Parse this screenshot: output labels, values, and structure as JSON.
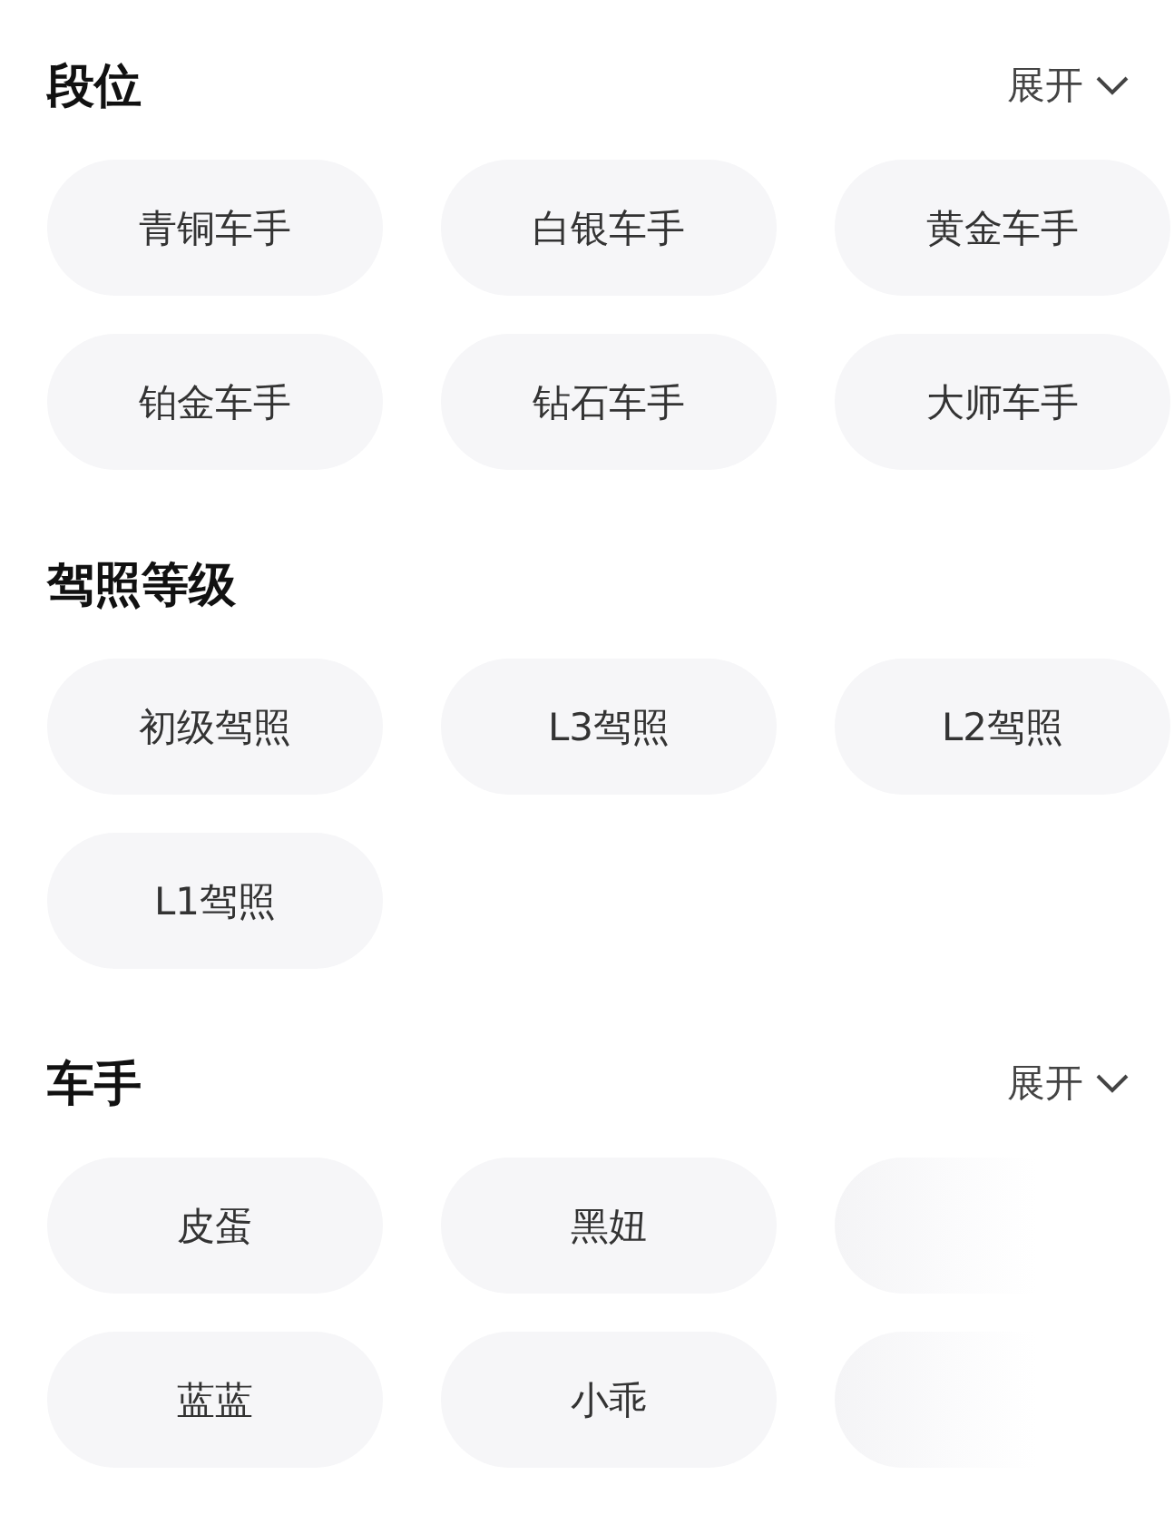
{
  "sections": [
    {
      "title": "段位",
      "expand_label": "展开",
      "chips": [
        {
          "kind": "text",
          "label": "青铜车手"
        },
        {
          "kind": "text",
          "label": "白银车手"
        },
        {
          "kind": "text",
          "label": "黄金车手"
        },
        {
          "kind": "text",
          "label": "铂金车手"
        },
        {
          "kind": "text",
          "label": "钻石车手"
        },
        {
          "kind": "text",
          "label": "大师车手"
        }
      ]
    },
    {
      "title": "驾照等级",
      "chips": [
        {
          "kind": "text",
          "label": "初级驾照"
        },
        {
          "kind": "text",
          "label": "L3驾照"
        },
        {
          "kind": "text",
          "label": "L2驾照"
        },
        {
          "kind": "text",
          "label": "L1驾照"
        }
      ]
    },
    {
      "title": "车手",
      "expand_label": "展开",
      "chips": [
        {
          "kind": "text",
          "label": "皮蛋"
        },
        {
          "kind": "text",
          "label": "黑妞"
        },
        {
          "kind": "faded"
        },
        {
          "kind": "text",
          "label": "蓝蓝"
        },
        {
          "kind": "text",
          "label": "小乖"
        },
        {
          "kind": "faded"
        }
      ]
    }
  ]
}
